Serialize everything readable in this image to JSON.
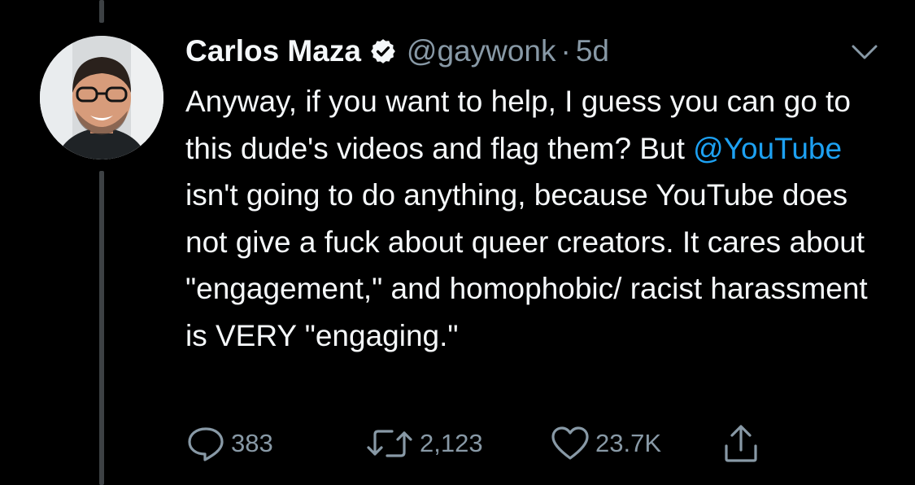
{
  "tweet": {
    "author_name": "Carlos Maza",
    "verified_icon": "verified-badge-icon",
    "handle": "@gaywonk",
    "separator": "·",
    "time": "5d",
    "text_part1": "Anyway, if you want to help, I guess you can go to this dude's videos and flag them? But ",
    "mention": "@YouTube",
    "text_part2": " isn't going to do anything, because YouTube does not give a fuck about queer creators. It cares about \"engagement,\" and homophobic/ racist harassment is VERY \"engaging.\"",
    "mention_color": "#1da1f2"
  },
  "actions": {
    "reply_count": "383",
    "retweet_count": "2,123",
    "like_count": "23.7K"
  },
  "colors": {
    "background": "#000000",
    "primary_text": "#f5f8fa",
    "secondary_text": "#8899a6",
    "thread_line": "#3d4144"
  }
}
